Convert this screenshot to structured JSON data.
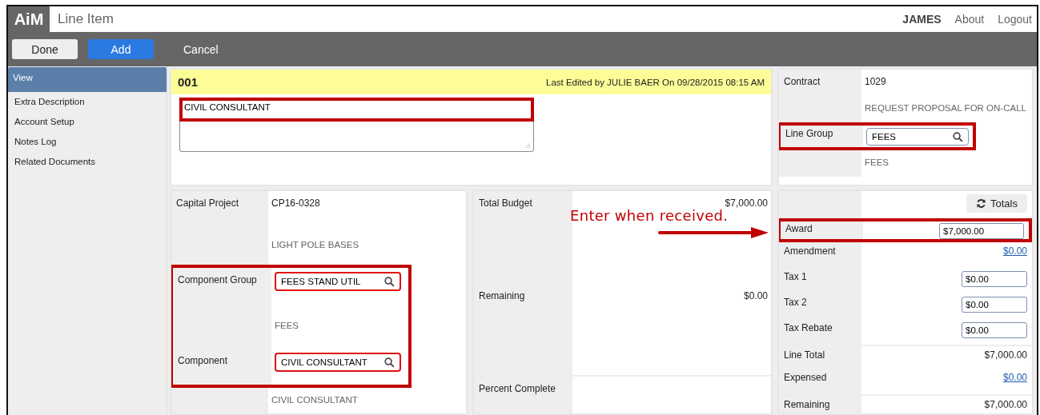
{
  "app": {
    "logo": "AiM",
    "title": "Line Item"
  },
  "user_menu": [
    {
      "label": "JAMES",
      "kind": "user"
    },
    {
      "label": "About",
      "kind": "link"
    },
    {
      "label": "Logout",
      "kind": "link"
    }
  ],
  "toolbar": [
    {
      "label": "Done",
      "kind": "default"
    },
    {
      "label": "Add",
      "kind": "primary"
    },
    {
      "label": "Cancel",
      "kind": "plain"
    }
  ],
  "sidebar": {
    "items": [
      {
        "label": "View",
        "selected": true
      },
      {
        "label": "Extra Description",
        "selected": false
      },
      {
        "label": "Account Setup",
        "selected": false
      },
      {
        "label": "Notes Log",
        "selected": false
      },
      {
        "label": "Related Documents",
        "selected": false
      }
    ]
  },
  "record": {
    "number": "001",
    "last_edited": "Last Edited by JULIE BAER On 09/28/2015 08:15 AM",
    "description": {
      "value": "CIVIL CONSULTANT",
      "highlighted": true
    }
  },
  "contract_panel": {
    "rows": [
      {
        "kind": "text",
        "label": "Contract",
        "value": "1029"
      },
      {
        "kind": "desc",
        "value": "REQUEST PROPOSAL FOR ON-CALL"
      },
      {
        "kind": "lookup",
        "label": "Line Group",
        "value": "FEES",
        "highlighted": true
      },
      {
        "kind": "desc",
        "value": "FEES"
      }
    ]
  },
  "project_panel": {
    "groups": [
      {
        "highlighted": false,
        "rows": [
          {
            "kind": "text",
            "label": "Capital Project",
            "value": "CP16-0328"
          },
          {
            "kind": "desc",
            "value": "LIGHT POLE BASES"
          }
        ]
      },
      {
        "highlighted": true,
        "rows": [
          {
            "kind": "lookup",
            "label": "Component Group",
            "value": "FEES STAND UTIL"
          },
          {
            "kind": "desc",
            "value": "FEES"
          },
          {
            "kind": "lookup",
            "label": "Component",
            "value": "CIVIL CONSULTANT"
          }
        ]
      },
      {
        "highlighted": false,
        "rows": [
          {
            "kind": "desc",
            "value": "CIVIL CONSULTANT"
          }
        ]
      }
    ]
  },
  "budget_panel": {
    "rows": [
      {
        "label": "Total Budget",
        "value": "$7,000.00"
      },
      {
        "label": "Remaining",
        "value": "$0.00"
      },
      {
        "label": "Percent Complete"
      }
    ]
  },
  "totals_panel": {
    "button": "Totals",
    "rows": [
      {
        "kind": "input",
        "label": "Award",
        "value": "$7,000.00",
        "highlighted": true
      },
      {
        "kind": "link",
        "label": "Amendment",
        "value": "$0.00",
        "highlighted": false
      },
      {
        "kind": "input",
        "label": "Tax 1",
        "value": "$0.00",
        "highlighted": false
      },
      {
        "kind": "input",
        "label": "Tax 2",
        "value": "$0.00",
        "highlighted": false
      },
      {
        "kind": "input",
        "label": "Tax Rebate",
        "value": "$0.00",
        "highlighted": false
      },
      {
        "kind": "text",
        "label": "Line Total",
        "value": "$7,000.00",
        "highlighted": false
      },
      {
        "kind": "link",
        "label": "Expensed",
        "value": "$0.00",
        "highlighted": false
      },
      {
        "kind": "text",
        "label": "Remaining",
        "value": "$7,000.00",
        "highlighted": false
      }
    ]
  },
  "annotation": {
    "text": "Enter when received."
  }
}
